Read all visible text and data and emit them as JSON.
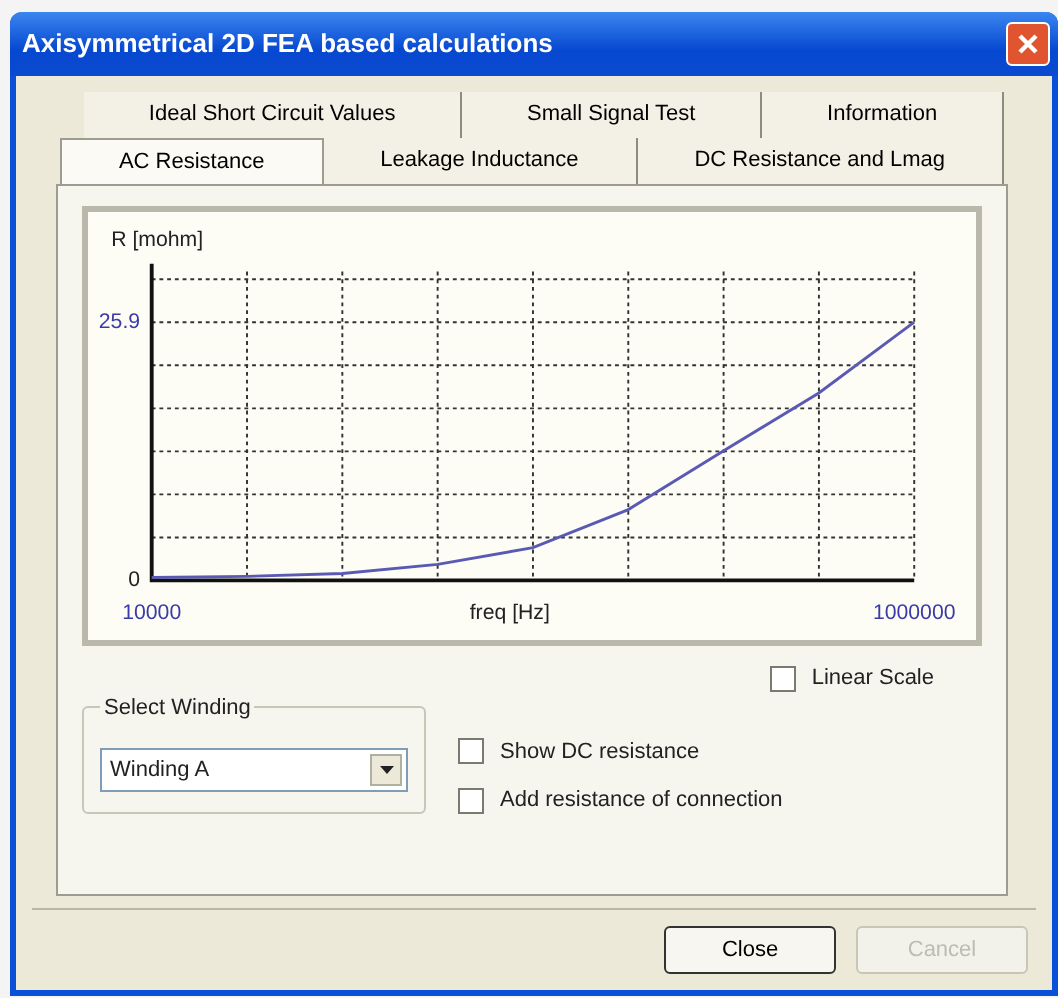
{
  "window": {
    "title": "Axisymmetrical 2D FEA based calculations"
  },
  "tab_rows": [
    [
      {
        "label": "Ideal Short Circuit Values",
        "selected": false
      },
      {
        "label": "Small Signal Test",
        "selected": false
      },
      {
        "label": "Information",
        "selected": false
      }
    ],
    [
      {
        "label": "AC Resistance",
        "selected": true
      },
      {
        "label": "Leakage Inductance",
        "selected": false
      },
      {
        "label": "DC Resistance and Lmag",
        "selected": false
      }
    ]
  ],
  "chart": {
    "chart_data": {
      "type": "line",
      "xlabel": "freq [Hz]",
      "ylabel": "R [mohm]",
      "x": [
        10000,
        133750,
        257500,
        381250,
        505000,
        628750,
        752500,
        876250,
        1000000
      ],
      "series": [
        {
          "color": "#5a5ab4",
          "values": [
            0.3,
            0.4,
            0.7,
            1.6,
            3.3,
            7.1,
            13,
            18.8,
            25.9
          ]
        }
      ],
      "xlim": [
        10000,
        1000000
      ],
      "ylim": [
        0,
        30.2
      ],
      "xticks": [
        10000,
        1000000
      ],
      "yticks": [
        0,
        25.9
      ]
    }
  },
  "linear_scale": {
    "label": "Linear Scale",
    "checked": false
  },
  "select_winding": {
    "legend": "Select Winding",
    "value": "Winding A"
  },
  "options": [
    {
      "label": "Show DC resistance",
      "checked": false
    },
    {
      "label": "Add resistance of connection",
      "checked": false
    }
  ],
  "buttons": [
    {
      "label": "Close",
      "disabled": false
    },
    {
      "label": "Cancel",
      "disabled": true
    }
  ]
}
